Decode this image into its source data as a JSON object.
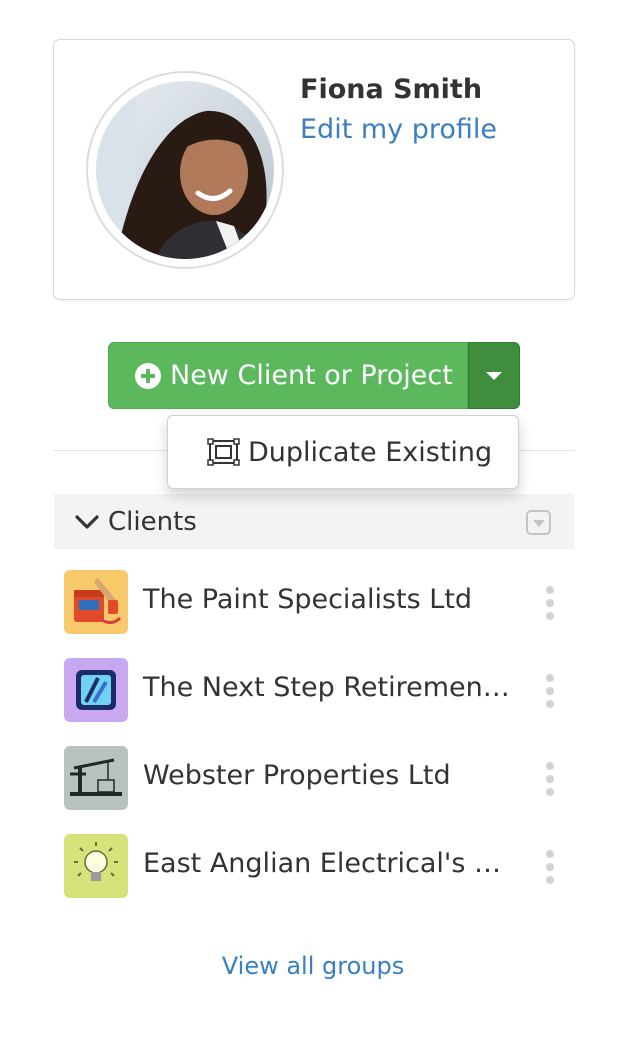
{
  "profile": {
    "name": "Fiona Smith",
    "edit_link": "Edit my profile"
  },
  "actions": {
    "new_button_label": "New Client or Project",
    "menu_items": [
      {
        "label": "Duplicate Existing",
        "icon": "duplicate-icon"
      }
    ]
  },
  "group": {
    "title": "Clients",
    "icon": "chevron-down-icon"
  },
  "clients": [
    {
      "name": "The Paint Specialists Ltd",
      "logo_color": "#f7c96b"
    },
    {
      "name": "The Next Step Retirement ...",
      "logo_color": "#c9a8f2"
    },
    {
      "name": "Webster Properties Ltd",
      "logo_color": "#b9c3bd"
    },
    {
      "name": "East Anglian Electrical's Ltd",
      "logo_color": "#d6e27a"
    }
  ],
  "footer": {
    "view_all": "View all groups"
  },
  "colors": {
    "primary_green": "#5cb85c",
    "dark_green": "#3e8e3e",
    "link_blue": "#3a7fc2"
  }
}
